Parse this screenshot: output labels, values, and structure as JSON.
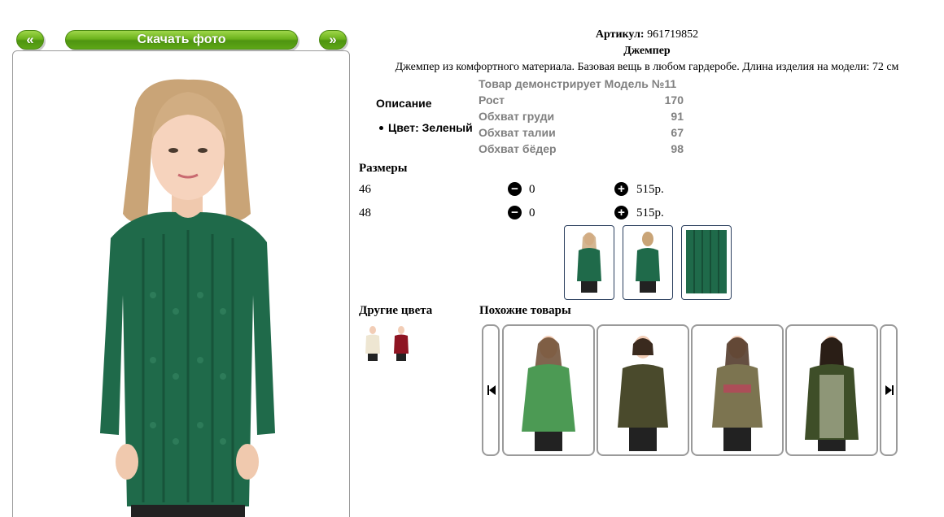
{
  "nav": {
    "prev_label": "«",
    "download_label": "Скачать фото",
    "next_label": "»"
  },
  "product": {
    "article_label": "Артикул:",
    "article_value": "961719852",
    "name": "Джемпер",
    "description": "Джемпер из комфортного материала. Базовая вещь в любом гардеробе. Длина изделия на модели: 72 см",
    "description_heading": "Описание",
    "color_text": "Цвет: Зеленый",
    "color_hex": "#1f6a4a"
  },
  "model": {
    "heading": "Товар демонстрирует Модель №11",
    "rows": [
      {
        "label": "Рост",
        "value": "170"
      },
      {
        "label": "Обхват груди",
        "value": "91"
      },
      {
        "label": "Обхват талии",
        "value": "67"
      },
      {
        "label": "Обхват бёдер",
        "value": "98"
      }
    ]
  },
  "sizes": {
    "heading": "Размеры",
    "rows": [
      {
        "size": "46",
        "qty": "0",
        "price": "515р."
      },
      {
        "size": "48",
        "qty": "0",
        "price": "515р."
      }
    ]
  },
  "other_colors": {
    "heading": "Другие цвета",
    "swatches": [
      "#eee6d2",
      "#8e1422"
    ]
  },
  "similar": {
    "heading": "Похожие товары",
    "items": [
      {
        "color": "#4c9a54",
        "icon": "sweater-green-icon"
      },
      {
        "color": "#4a4a2c",
        "icon": "sweater-olive-dark-icon"
      },
      {
        "color": "#7c7450",
        "icon": "sweatshirt-khaki-icon"
      },
      {
        "color": "#3e4e28",
        "icon": "cardigan-olive-icon"
      }
    ]
  },
  "colors": {
    "button_green": "#6cb31c",
    "muted_text": "#808080",
    "frame_border": "#9a9a9a",
    "thumb_border": "#2b3f5e"
  }
}
